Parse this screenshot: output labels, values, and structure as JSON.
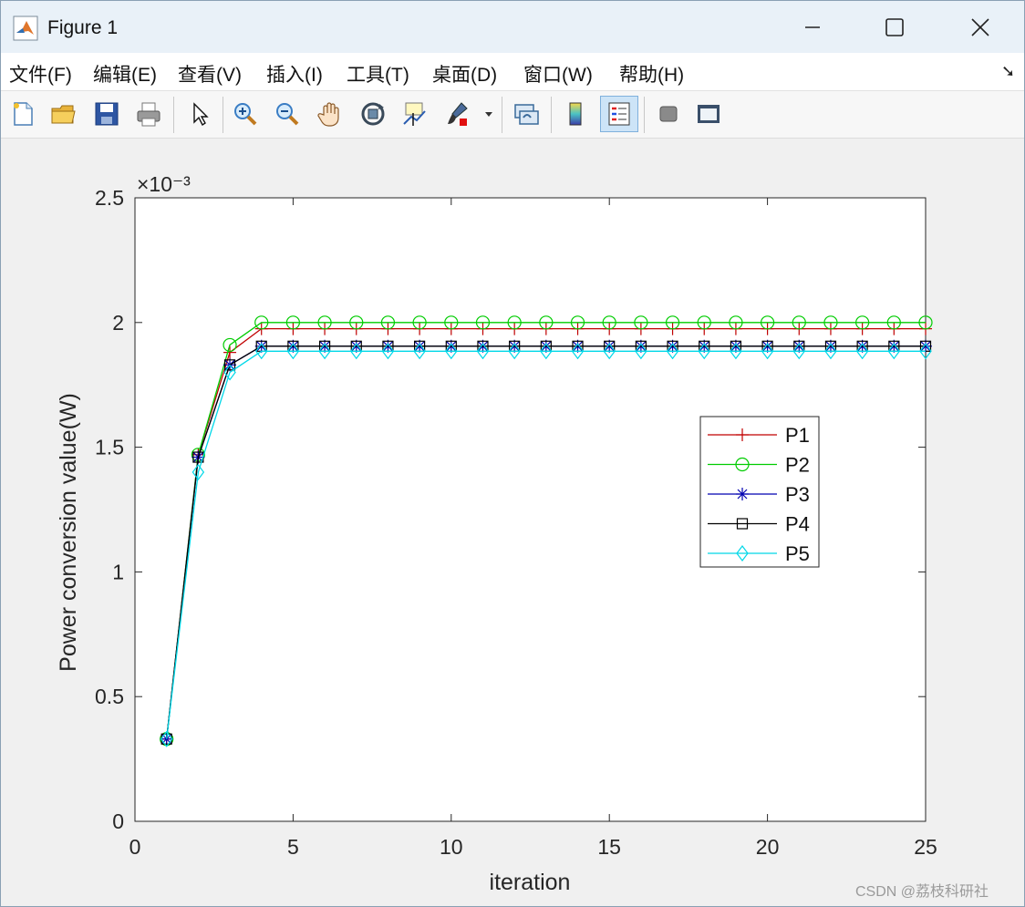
{
  "window": {
    "title": "Figure 1",
    "controls": [
      "minimize",
      "maximize",
      "close"
    ]
  },
  "menu": {
    "items": [
      "文件(F)",
      "编辑(E)",
      "查看(V)",
      "插入(I)",
      "工具(T)",
      "桌面(D)",
      "窗口(W)",
      "帮助(H)"
    ]
  },
  "toolbar": {
    "icons": [
      "new-figure-icon",
      "open-file-icon",
      "save-icon",
      "print-icon",
      "pointer-icon",
      "zoom-in-icon",
      "zoom-out-icon",
      "pan-hand-icon",
      "rotate-3d-icon",
      "data-cursor-icon",
      "brush-icon",
      "link-plot-icon",
      "colorbar-icon",
      "legend-icon",
      "hide-plot-tools-icon",
      "show-plot-tools-icon"
    ],
    "active": "legend-icon"
  },
  "chart_data": {
    "type": "line",
    "xlabel": "iteration",
    "ylabel": "Power conversion value(W)",
    "exponent_label": "×10⁻³",
    "xlim": [
      0,
      25
    ],
    "ylim": [
      0,
      2.5
    ],
    "xticks": [
      0,
      5,
      10,
      15,
      20,
      25
    ],
    "yticks": [
      0,
      0.5,
      1,
      1.5,
      2,
      2.5
    ],
    "ytick_labels": [
      "0",
      "0.5",
      "1",
      "1.5",
      "2",
      "2.5"
    ],
    "grid": false,
    "legend_position": "right-center",
    "x": [
      1,
      2,
      3,
      4,
      5,
      6,
      7,
      8,
      9,
      10,
      11,
      12,
      13,
      14,
      15,
      16,
      17,
      18,
      19,
      20,
      21,
      22,
      23,
      24,
      25
    ],
    "series": [
      {
        "name": "P1",
        "color": "#c00000",
        "marker": "plus",
        "values": [
          0.33,
          1.47,
          1.88,
          1.975,
          1.975,
          1.975,
          1.975,
          1.975,
          1.975,
          1.975,
          1.975,
          1.975,
          1.975,
          1.975,
          1.975,
          1.975,
          1.975,
          1.975,
          1.975,
          1.975,
          1.975,
          1.975,
          1.975,
          1.975,
          1.975
        ]
      },
      {
        "name": "P2",
        "color": "#00cc00",
        "marker": "circle",
        "values": [
          0.33,
          1.47,
          1.91,
          2.0,
          2.0,
          2.0,
          2.0,
          2.0,
          2.0,
          2.0,
          2.0,
          2.0,
          2.0,
          2.0,
          2.0,
          2.0,
          2.0,
          2.0,
          2.0,
          2.0,
          2.0,
          2.0,
          2.0,
          2.0,
          2.0
        ]
      },
      {
        "name": "P3",
        "color": "#0000b0",
        "marker": "star",
        "values": [
          0.33,
          1.46,
          1.83,
          1.905,
          1.905,
          1.905,
          1.905,
          1.905,
          1.905,
          1.905,
          1.905,
          1.905,
          1.905,
          1.905,
          1.905,
          1.905,
          1.905,
          1.905,
          1.905,
          1.905,
          1.905,
          1.905,
          1.905,
          1.905,
          1.905
        ]
      },
      {
        "name": "P4",
        "color": "#000000",
        "marker": "square",
        "values": [
          0.33,
          1.46,
          1.83,
          1.905,
          1.905,
          1.905,
          1.905,
          1.905,
          1.905,
          1.905,
          1.905,
          1.905,
          1.905,
          1.905,
          1.905,
          1.905,
          1.905,
          1.905,
          1.905,
          1.905,
          1.905,
          1.905,
          1.905,
          1.905,
          1.905
        ]
      },
      {
        "name": "P5",
        "color": "#00d8e8",
        "marker": "diamond",
        "values": [
          0.33,
          1.4,
          1.8,
          1.885,
          1.885,
          1.885,
          1.885,
          1.885,
          1.885,
          1.885,
          1.885,
          1.885,
          1.885,
          1.885,
          1.885,
          1.885,
          1.885,
          1.885,
          1.885,
          1.885,
          1.885,
          1.885,
          1.885,
          1.885,
          1.885
        ]
      }
    ]
  },
  "watermark": "CSDN @荔枝科研社"
}
